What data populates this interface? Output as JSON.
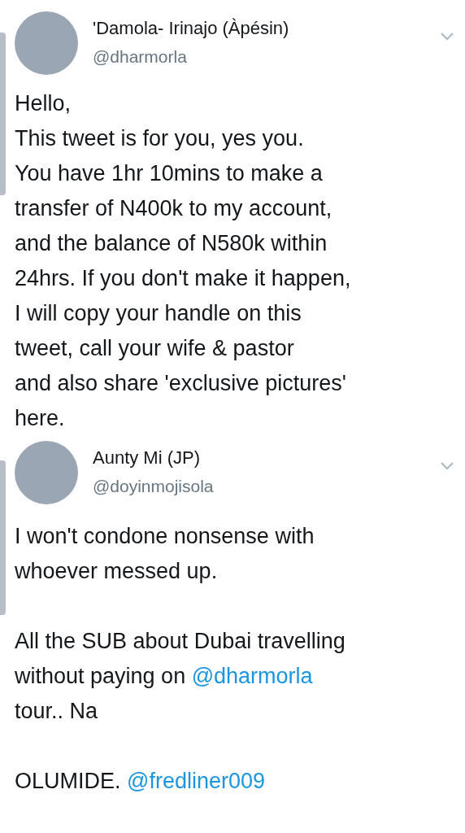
{
  "tweets": [
    {
      "name": "'Damola- Irinajo (Àpésin)",
      "handle": "@dharmorla",
      "paragraphs": [
        [
          [
            {
              "kind": "text",
              "text": "Hello,"
            }
          ],
          [
            {
              "kind": "text",
              "text": "This tweet is for you, yes you."
            }
          ],
          [
            {
              "kind": "text",
              "text": "You have 1hr 10mins to make a"
            }
          ],
          [
            {
              "kind": "text",
              "text": "transfer of N400k to my account,"
            }
          ],
          [
            {
              "kind": "text",
              "text": "and the balance of N580k within"
            }
          ],
          [
            {
              "kind": "text",
              "text": "24hrs. If you don't make it happen,"
            }
          ],
          [
            {
              "kind": "text",
              "text": "I will copy your handle on this"
            }
          ],
          [
            {
              "kind": "text",
              "text": "tweet, call your wife & pastor"
            }
          ],
          [
            {
              "kind": "text",
              "text": "and also share 'exclusive pictures'"
            }
          ],
          [
            {
              "kind": "text",
              "text": "here."
            }
          ]
        ]
      ]
    },
    {
      "name": "Aunty Mi (JP)",
      "handle": "@doyinmojisola",
      "paragraphs": [
        [
          [
            {
              "kind": "text",
              "text": "I won't condone nonsense with"
            }
          ],
          [
            {
              "kind": "text",
              "text": "whoever messed up."
            }
          ]
        ],
        [
          [
            {
              "kind": "text",
              "text": "All the SUB about Dubai travelling"
            }
          ],
          [
            {
              "kind": "text",
              "text": "without paying on "
            },
            {
              "kind": "mention",
              "text": "@dharmorla"
            }
          ],
          [
            {
              "kind": "text",
              "text": "tour.. Na"
            }
          ]
        ],
        [
          [
            {
              "kind": "text",
              "text": "OLUMIDE. "
            },
            {
              "kind": "mention",
              "text": "@fredliner009"
            }
          ]
        ]
      ]
    }
  ]
}
